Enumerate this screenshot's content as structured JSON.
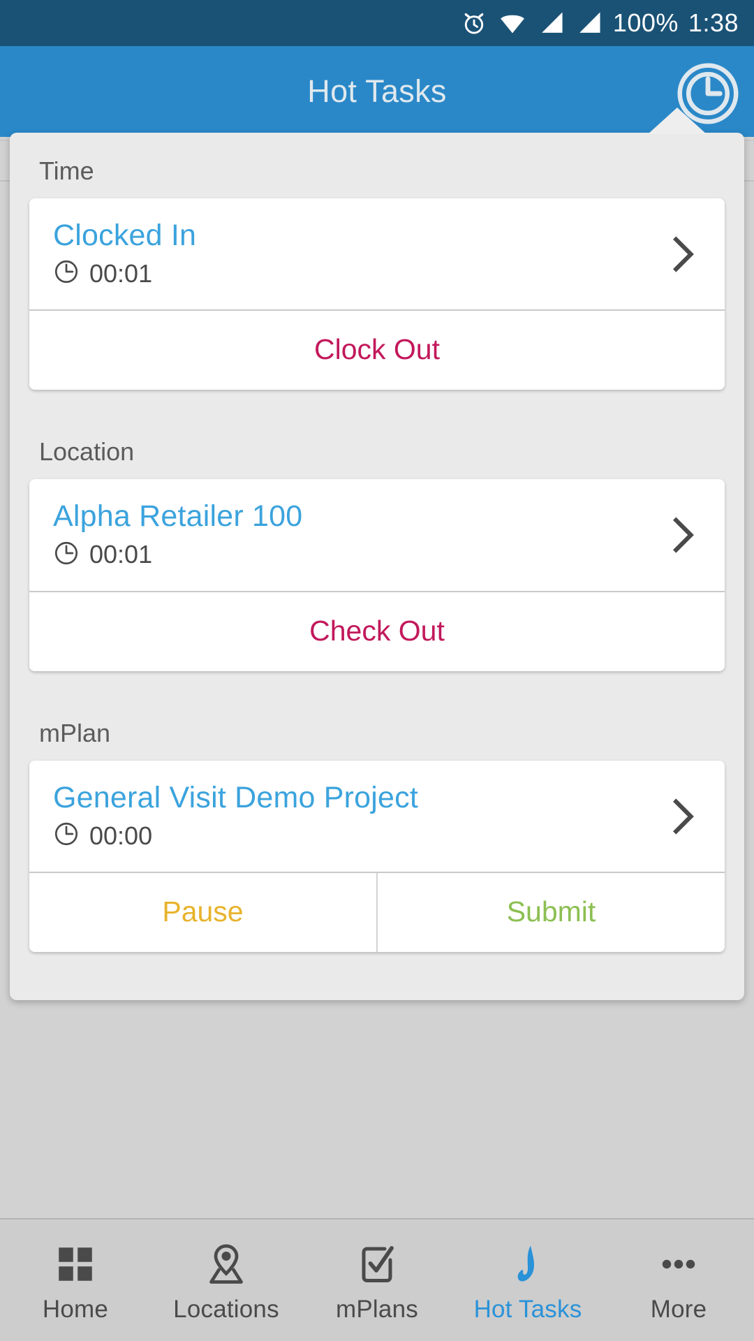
{
  "status_bar": {
    "battery": "100%",
    "time": "1:38",
    "icons": [
      "alarm-icon",
      "wifi-icon",
      "signal-icon",
      "signal-icon"
    ],
    "background_color": "#1a5276",
    "text_color": "#ffffff"
  },
  "app_bar": {
    "title": "Hot Tasks",
    "background_color": "#2a88c8",
    "title_color": "#dfe8ee",
    "action_icon": "clock-icon"
  },
  "popup": {
    "background_color": "#eaeaea",
    "sections": [
      {
        "label": "Time",
        "card": {
          "title": "Clocked In",
          "title_color": "#3ba3dd",
          "timer_icon": "clock-icon",
          "timer": "00:01",
          "chevron_icon": "chevron-right-icon",
          "actions": [
            {
              "label": "Clock Out",
              "style": "danger",
              "color": "#c2185b"
            }
          ]
        }
      },
      {
        "label": "Location",
        "card": {
          "title": "Alpha Retailer 100",
          "title_color": "#3ba3dd",
          "timer_icon": "clock-icon",
          "timer": "00:01",
          "chevron_icon": "chevron-right-icon",
          "actions": [
            {
              "label": "Check Out",
              "style": "danger",
              "color": "#c2185b"
            }
          ]
        }
      },
      {
        "label": "mPlan",
        "card": {
          "title": "General Visit Demo Project",
          "title_color": "#3ba3dd",
          "timer_icon": "clock-icon",
          "timer": "00:00",
          "chevron_icon": "chevron-right-icon",
          "actions": [
            {
              "label": "Pause",
              "style": "warn",
              "color": "#e8b32c"
            },
            {
              "label": "Submit",
              "style": "success",
              "color": "#8cbf52"
            }
          ]
        }
      }
    ]
  },
  "bottom_nav": {
    "active_color": "#2a92d8",
    "inactive_color": "#4a4a4a",
    "items": [
      {
        "label": "Home",
        "icon": "grid-icon",
        "active": false
      },
      {
        "label": "Locations",
        "icon": "map-pin-icon",
        "active": false
      },
      {
        "label": "mPlans",
        "icon": "checkbox-icon",
        "active": false
      },
      {
        "label": "Hot Tasks",
        "icon": "flame-icon",
        "active": true
      },
      {
        "label": "More",
        "icon": "ellipsis-icon",
        "active": false
      }
    ]
  }
}
